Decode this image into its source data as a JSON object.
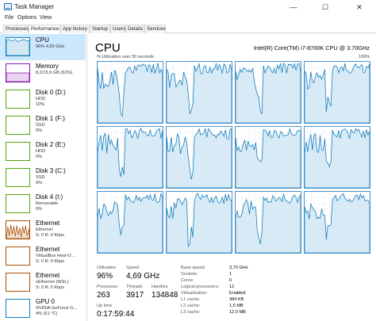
{
  "window": {
    "title": "Task Manager",
    "minimize": "—",
    "maximize": "☐",
    "close": "✕"
  },
  "menu": [
    "File",
    "Options",
    "View"
  ],
  "tabs": [
    "Processes",
    "Performance",
    "App history",
    "Startup",
    "Users",
    "Details",
    "Services"
  ],
  "active_tab": "Performance",
  "sidebar": [
    {
      "name": "CPU",
      "lines": [
        "96% 4,69 GHz"
      ],
      "color": "#117dbb",
      "active": true
    },
    {
      "name": "Memory",
      "lines": [
        "8,2/15,9 GB (52%)"
      ],
      "color": "#8b12ae"
    },
    {
      "name": "Disk 0 (D:)",
      "lines": [
        "HDD",
        "10%"
      ],
      "color": "#4da60c"
    },
    {
      "name": "Disk 1 (F:)",
      "lines": [
        "SSD",
        "0%"
      ],
      "color": "#4da60c"
    },
    {
      "name": "Disk 2 (E:)",
      "lines": [
        "HDD",
        "0%"
      ],
      "color": "#4da60c"
    },
    {
      "name": "Disk 3 (C:)",
      "lines": [
        "SSD",
        "0%"
      ],
      "color": "#4da60c"
    },
    {
      "name": "Disk 4 (I:)",
      "lines": [
        "Removable",
        "0%"
      ],
      "color": "#4da60c"
    },
    {
      "name": "Ethernet",
      "lines": [
        "Ethernet",
        "S: 0 R: 0 Kbps"
      ],
      "color": "#a74f01"
    },
    {
      "name": "Ethernet",
      "lines": [
        "VirtualBox Host-O...",
        "S: 0 R: 0 Kbps"
      ],
      "color": "#a74f01"
    },
    {
      "name": "Ethernet",
      "lines": [
        "vEthernet (WSL)",
        "S: 0 R: 0 Kbps"
      ],
      "color": "#a74f01"
    },
    {
      "name": "GPU 0",
      "lines": [
        "NVIDIA GeForce G...",
        "4% (51 °C)"
      ],
      "color": "#117dbb"
    }
  ],
  "cpu": {
    "title": "CPU",
    "model": "Intel(R) Core(TM) i7-8700K CPU @ 3.70GHz",
    "util_label": "% Utilization over 30 seconds",
    "util_max": "100%"
  },
  "stats": {
    "utilization_label": "Utilization",
    "utilization": "96%",
    "speed_label": "Speed",
    "speed": "4,69 GHz",
    "processes_label": "Processes",
    "processes": "263",
    "threads_label": "Threads",
    "threads": "3917",
    "handles_label": "Handles",
    "handles": "134848",
    "uptime_label": "Up time",
    "uptime": "0:17:59:44"
  },
  "specs": [
    {
      "key": "Base speed:",
      "value": "3,70 GHz"
    },
    {
      "key": "Sockets:",
      "value": "1"
    },
    {
      "key": "Cores:",
      "value": "6"
    },
    {
      "key": "Logical processors:",
      "value": "12"
    },
    {
      "key": "Virtualization:",
      "value": "Enabled"
    },
    {
      "key": "L1 cache:",
      "value": "384 KB"
    },
    {
      "key": "L2 cache:",
      "value": "1,5 MB"
    },
    {
      "key": "L3 cache:",
      "value": "12,0 MB"
    }
  ],
  "colors": {
    "graph_line": "#117dbb",
    "graph_fill": "#d9eaf7",
    "graph_border": "#4a90c8",
    "selected": "#cce8ff"
  }
}
